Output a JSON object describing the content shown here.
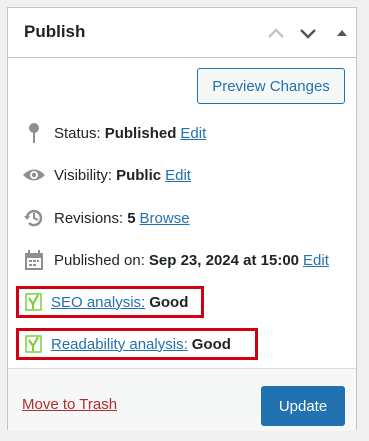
{
  "panel": {
    "title": "Publish",
    "colors": {
      "accent": "#2271b1",
      "danger": "#b32d2e",
      "highlight": "#d00012",
      "yoast_green": "#7ad03a"
    }
  },
  "actions": {
    "preview_label": "Preview Changes",
    "trash_label": "Move to Trash",
    "update_label": "Update"
  },
  "status": {
    "label": "Status:",
    "value": "Published",
    "edit": "Edit",
    "icon": "pin-icon"
  },
  "visibility": {
    "label": "Visibility:",
    "value": "Public",
    "edit": "Edit",
    "icon": "eye-icon"
  },
  "revisions": {
    "label": "Revisions:",
    "value": "5",
    "link": "Browse",
    "icon": "history-icon"
  },
  "published": {
    "label": "Published on:",
    "value": "Sep 23, 2024 at 15:00",
    "edit": "Edit",
    "icon": "calendar-icon"
  },
  "seo": {
    "link": "SEO analysis:",
    "value": "Good",
    "icon": "yoast-icon"
  },
  "readability": {
    "link": "Readability analysis:",
    "value": "Good",
    "icon": "yoast-icon"
  }
}
